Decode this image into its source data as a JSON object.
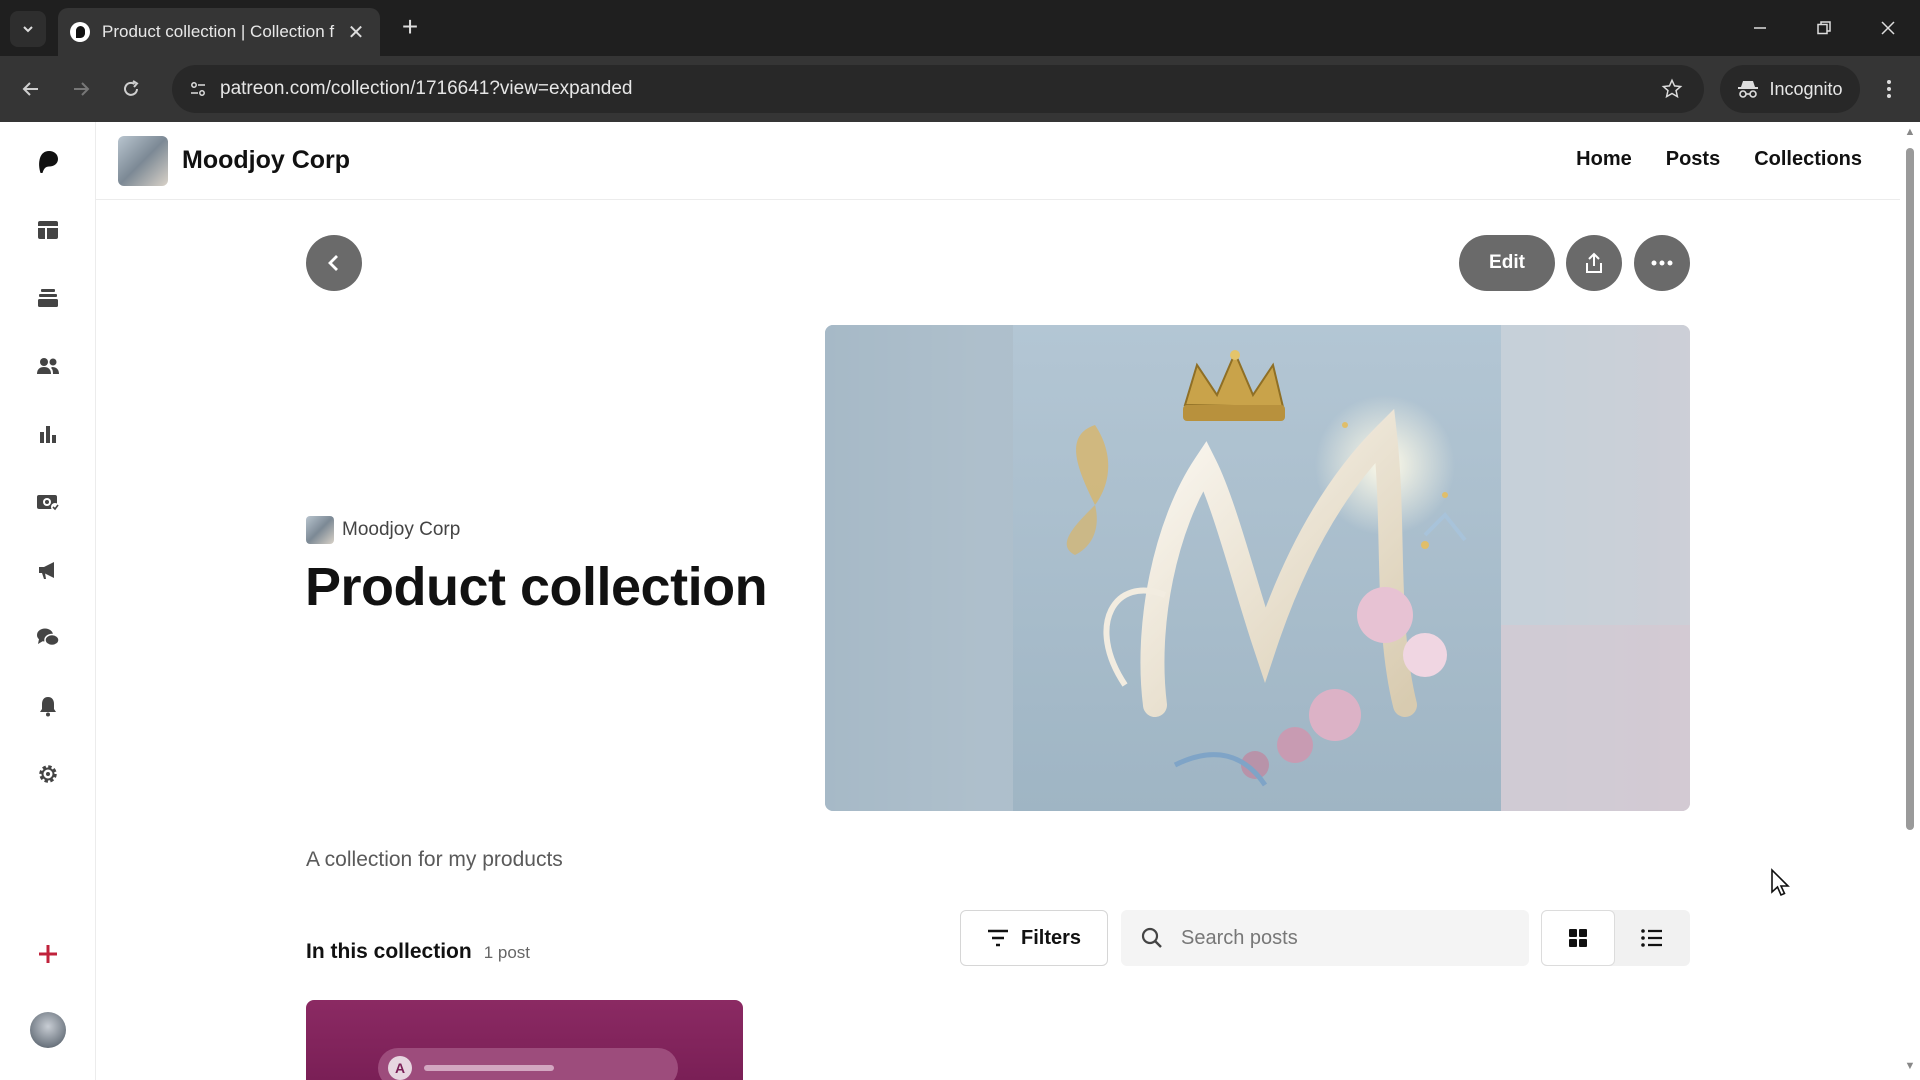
{
  "browser": {
    "tab_title": "Product collection | Collection f",
    "url": "patreon.com/collection/1716641?view=expanded",
    "incognito_label": "Incognito"
  },
  "header": {
    "creator_name": "Moodjoy Corp",
    "nav": [
      "Home",
      "Posts",
      "Collections"
    ]
  },
  "actions": {
    "edit_label": "Edit"
  },
  "collection": {
    "byline": "Moodjoy Corp",
    "title": "Product collection",
    "description": "A collection for my products",
    "in_collection_label": "In this collection",
    "post_count": "1 post"
  },
  "toolbar": {
    "filters_label": "Filters",
    "search_placeholder": "Search posts"
  },
  "post_preview": {
    "avatar_letter": "A"
  },
  "colors": {
    "accent_dark": "#6a6a6a",
    "post_card": "#8b2a63"
  }
}
